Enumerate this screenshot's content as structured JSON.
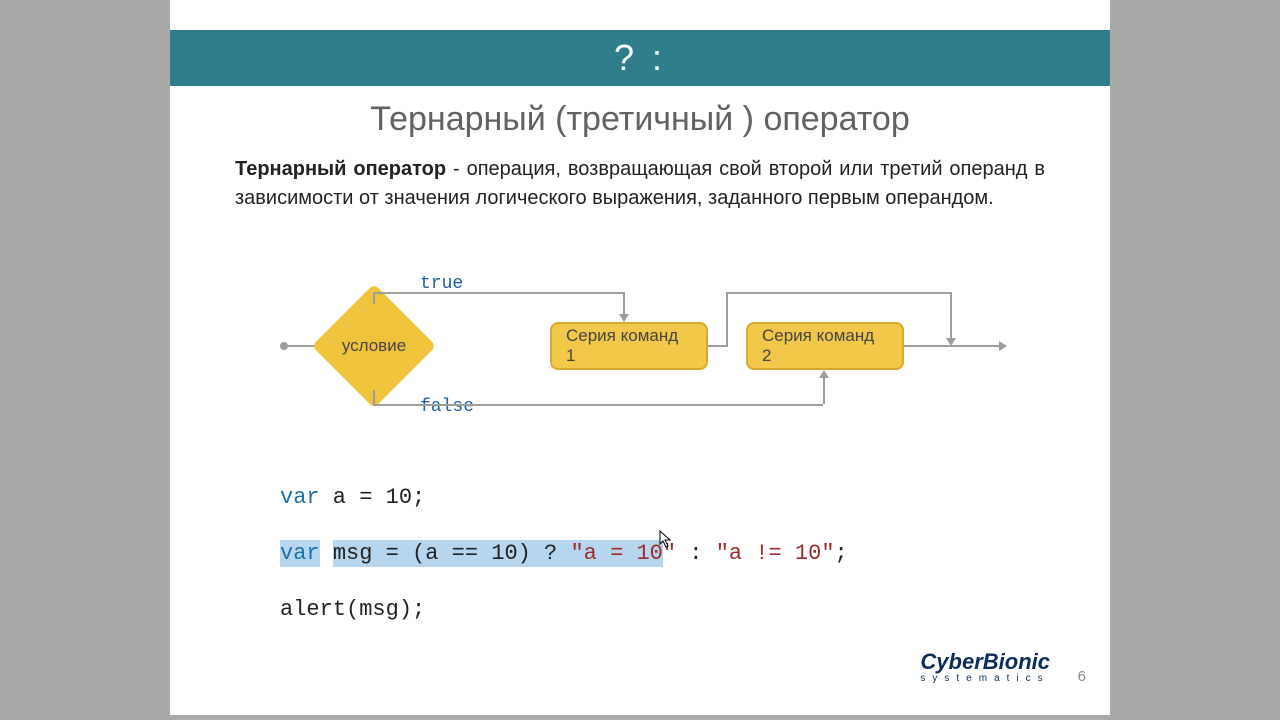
{
  "header": {
    "title": "? :"
  },
  "subtitle": "Тернарный (третичный ) оператор",
  "desc": {
    "bold": "Тернарный оператор",
    "rest": " - операция, возвращающая свой второй или третий операнд в зависимости от значения логического выражения, заданного первым операндом."
  },
  "diagram": {
    "condition": "условие",
    "true_label": "true",
    "false_label": "false",
    "box1": "Серия команд 1",
    "box2": "Серия команд 2"
  },
  "code": {
    "line1": {
      "kw": "var",
      "rest": " a = 10;"
    },
    "line2": {
      "kw": "var",
      "var_name": " msg ",
      "eq_open": "= (a == 10) ? ",
      "str1_q": "\"a = 10",
      "post_cursor": "\"",
      "mid": " : ",
      "str2": "\"a != 10\"",
      "end": ";"
    },
    "line3": "alert(msg);"
  },
  "logo": {
    "main": "CyberBionic",
    "sub": "systematics"
  },
  "page_number": "6"
}
